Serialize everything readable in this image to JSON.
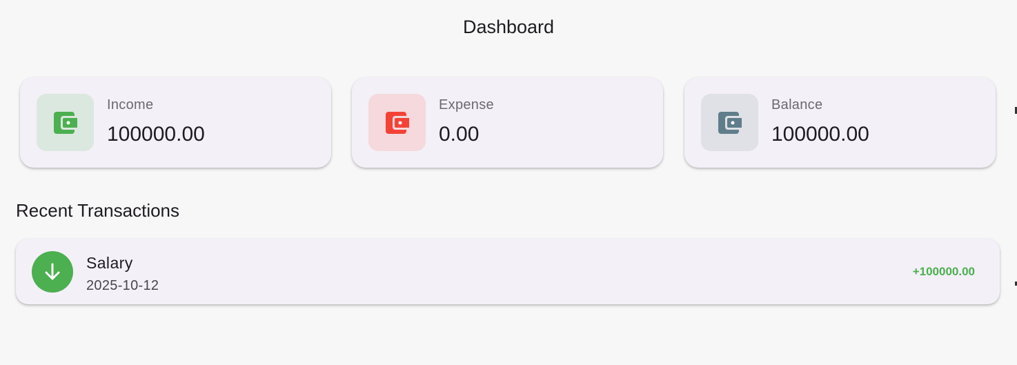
{
  "app_title": "Dashboard",
  "summary_cards": [
    {
      "label": "Income",
      "value": "100000.00",
      "icon": "wallet-icon",
      "icon_color": "#4caf50",
      "icon_bg": "#dbe8df"
    },
    {
      "label": "Expense",
      "value": "0.00",
      "icon": "wallet-icon",
      "icon_color": "#f44336",
      "icon_bg": "#f5d9dc"
    },
    {
      "label": "Balance",
      "value": "100000.00",
      "icon": "wallet-icon",
      "icon_color": "#607d8b",
      "icon_bg": "#dfe1e6"
    }
  ],
  "recent": {
    "title": "Recent Transactions",
    "transactions": [
      {
        "title": "Salary",
        "date": "2025-10-12",
        "amount": "+100000.00",
        "type": "income",
        "icon": "arrow-down-icon",
        "color": "#4caf50"
      }
    ]
  }
}
